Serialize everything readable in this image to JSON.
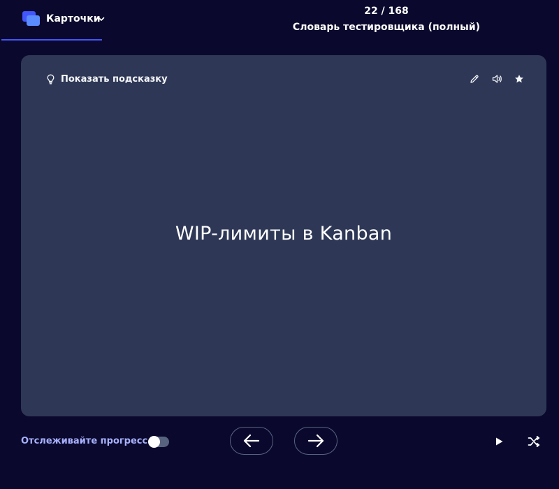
{
  "header": {
    "mode_label": "Карточки",
    "mode_icon": "cards-stack-icon",
    "counter": "22 / 168",
    "set_title": "Словарь тестировщика (полный)"
  },
  "card": {
    "hint_label": "Показать подсказку",
    "hint_icon": "lightbulb-icon",
    "tools": [
      "edit-icon",
      "audio-icon",
      "star-icon"
    ],
    "term": "WIP-лимиты в Kanban"
  },
  "footer": {
    "progress_label": "Отслеживайте прогресс",
    "progress_tracking_on": false,
    "prev_icon": "arrow-left-icon",
    "next_icon": "arrow-right-icon",
    "play_icon": "play-icon",
    "shuffle_icon": "shuffle-icon"
  },
  "colors": {
    "background": "#0a092d",
    "card": "#2e3856",
    "accent": "#4255ff",
    "progress_label": "#a8b1ff",
    "button_border": "#586380"
  }
}
